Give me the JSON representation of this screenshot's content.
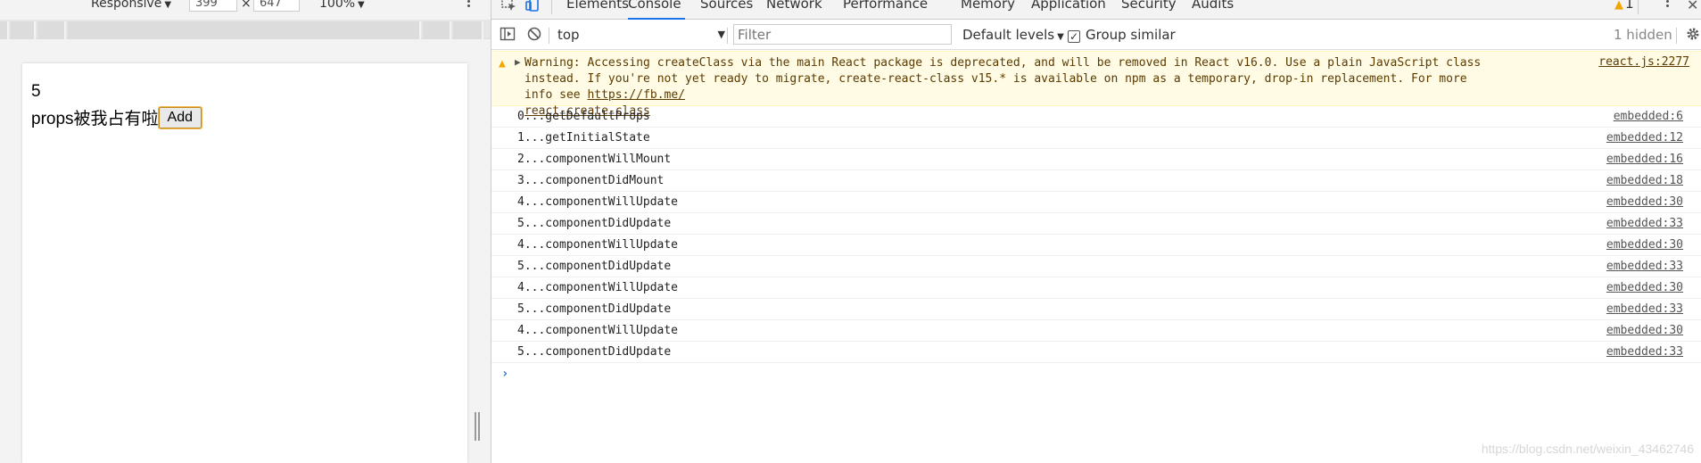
{
  "device_toolbar": {
    "mode_label": "Responsive",
    "width_value": "399",
    "times_symbol": "×",
    "height_value": "647",
    "zoom_label": "100%"
  },
  "viewport": {
    "count_text": "5",
    "line_text": "props被我占有啦",
    "add_button_label": "Add"
  },
  "devtools": {
    "tabs": [
      {
        "label": "Elements",
        "active": false
      },
      {
        "label": "Console",
        "active": true
      },
      {
        "label": "Sources",
        "active": false
      },
      {
        "label": "Network",
        "active": false
      },
      {
        "label": "Performance",
        "active": false
      },
      {
        "label": "Memory",
        "active": false
      },
      {
        "label": "Application",
        "active": false
      },
      {
        "label": "Security",
        "active": false
      },
      {
        "label": "Audits",
        "active": false
      }
    ],
    "warning_count": "1",
    "accent_color": "#1a73e8",
    "warning_color": "#f2a600"
  },
  "filterbar": {
    "context_label": "top",
    "filter_placeholder": "Filter",
    "levels_label": "Default levels",
    "group_similar_label": "Group similar",
    "group_similar_checked": true,
    "hidden_label": "1 hidden"
  },
  "console": {
    "warning": {
      "line1": "Warning: Accessing createClass via the main React package is deprecated, and will be removed in React v16.0. Use a plain JavaScript class",
      "line2": "instead. If you're not yet ready to migrate, create-react-class v15.* is available on npm as a temporary, drop-in replacement. For more info see",
      "link_a": "https://fb.me/",
      "link_b": "react-create-class",
      "source": "react.js:2277"
    },
    "logs": [
      {
        "message": "0...getDefaultProps",
        "source": "embedded:6"
      },
      {
        "message": "1...getInitialState",
        "source": "embedded:12"
      },
      {
        "message": "2...componentWillMount",
        "source": "embedded:16"
      },
      {
        "message": "3...componentDidMount",
        "source": "embedded:18"
      },
      {
        "message": "4...componentWillUpdate",
        "source": "embedded:30"
      },
      {
        "message": "5...componentDidUpdate",
        "source": "embedded:33"
      },
      {
        "message": "4...componentWillUpdate",
        "source": "embedded:30"
      },
      {
        "message": "5...componentDidUpdate",
        "source": "embedded:33"
      },
      {
        "message": "4...componentWillUpdate",
        "source": "embedded:30"
      },
      {
        "message": "5...componentDidUpdate",
        "source": "embedded:33"
      },
      {
        "message": "4...componentWillUpdate",
        "source": "embedded:30"
      },
      {
        "message": "5...componentDidUpdate",
        "source": "embedded:33"
      }
    ],
    "prompt_symbol": "›"
  },
  "watermark": "https://blog.csdn.net/weixin_43462746"
}
